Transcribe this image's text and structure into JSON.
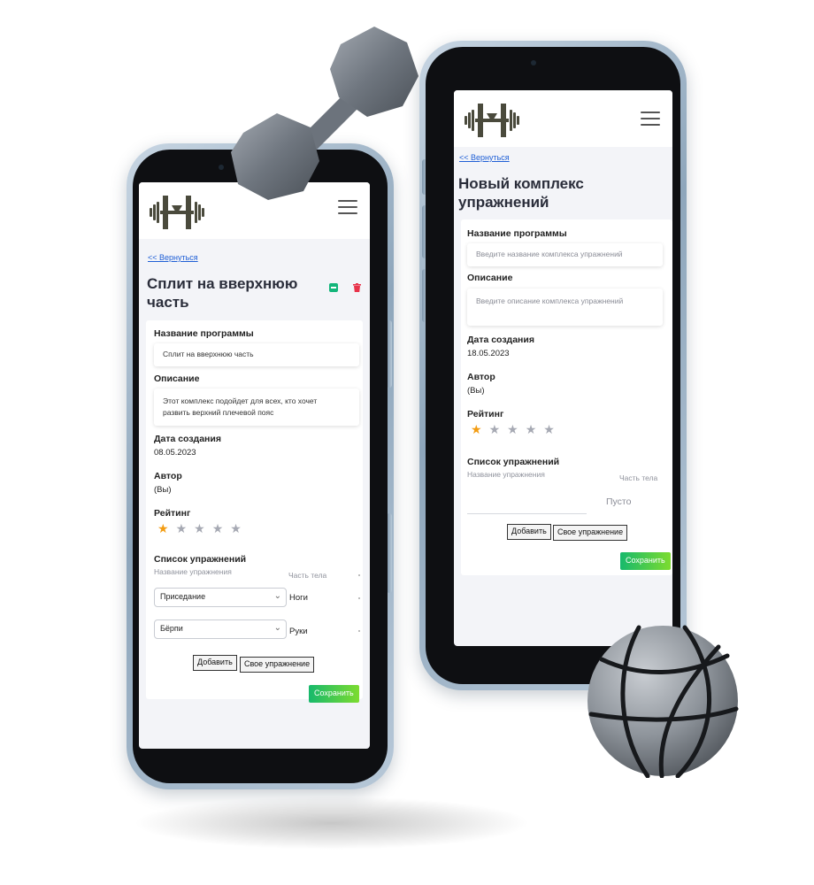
{
  "left_phone": {
    "back_link": "<< Вернуться",
    "title_line1": "Сплит на вверхнюю",
    "title_line2": "часть",
    "program_name_label": "Название программы",
    "program_name_value": "Сплит на вверхнюю часть",
    "description_label": "Описание",
    "description_line1": "Этот комплекс подойдет для всех, кто хочет",
    "description_line2": "развить верхний плечевой пояс",
    "created_label": "Дата создания",
    "created_value": "08.05.2023",
    "author_label": "Автор",
    "author_value": "(Вы)",
    "rating_label": "Рейтинг",
    "rating": 1,
    "exercises_label": "Список упражнений",
    "col_exercise": "Название упражнения",
    "col_body_part": "Часть тела",
    "rows": [
      {
        "exercise": "Приседание",
        "body_part": "Ноги"
      },
      {
        "exercise": "Бёрпи",
        "body_part": "Руки"
      }
    ],
    "add_button": "Добавить",
    "custom_button": "Свое упражнение",
    "save_button": "Сохранить"
  },
  "right_phone": {
    "back_link": "<< Вернуться",
    "title_line1": "Новый комплекс",
    "title_line2": "упражнений",
    "program_name_label": "Название программы",
    "program_name_placeholder": "Введите название комплекса упражнений",
    "description_label": "Описание",
    "description_placeholder": "Введите описание комплекса упражнений",
    "created_label": "Дата создания",
    "created_value": "18.05.2023",
    "author_label": "Автор",
    "author_value": "(Вы)",
    "rating_label": "Рейтинг",
    "rating": 1,
    "exercises_label": "Список упражнений",
    "col_exercise": "Название упражнения",
    "col_body_part": "Часть тела",
    "empty_text": "Пусто",
    "add_button": "Добавить",
    "custom_button": "Свое упражнение",
    "save_button": "Сохранить"
  },
  "colors": {
    "accent_green": "#17b96c",
    "star_active": "#f39c12",
    "delete_red": "#e8334a",
    "link_blue": "#1f5fd6"
  }
}
